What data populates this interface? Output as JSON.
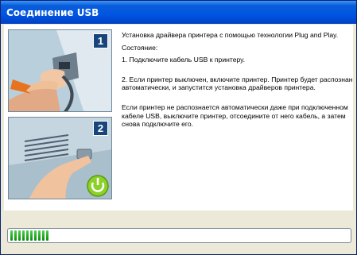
{
  "window": {
    "title": "Соединение USB"
  },
  "instructions": {
    "intro": "Установка драйвера принтера с помощью технологии Plug and Play.",
    "status_label": "Состояние:",
    "step1": "1. Подключите кабель USB к принтеру.",
    "step2": "2. Если принтер выключен, включите принтер. Принтер будет распознан автоматически, и запустится установка драйверов принтера.",
    "note": "Если принтер не распознается автоматически даже при подключенном кабеле USB, выключите принтер, отсоедините от него кабель, а затем снова подключите его."
  },
  "illustrations": [
    {
      "number": "1",
      "icon": "usb-plug-icon"
    },
    {
      "number": "2",
      "icon": "power-button-icon"
    }
  ],
  "progress": {
    "segments": 10,
    "fraction": 0.08
  },
  "colors": {
    "title_bar": "#0054e3",
    "progress_fill": "#1fa81f",
    "power_icon": "#7ac81e",
    "badge": "#18467c"
  }
}
